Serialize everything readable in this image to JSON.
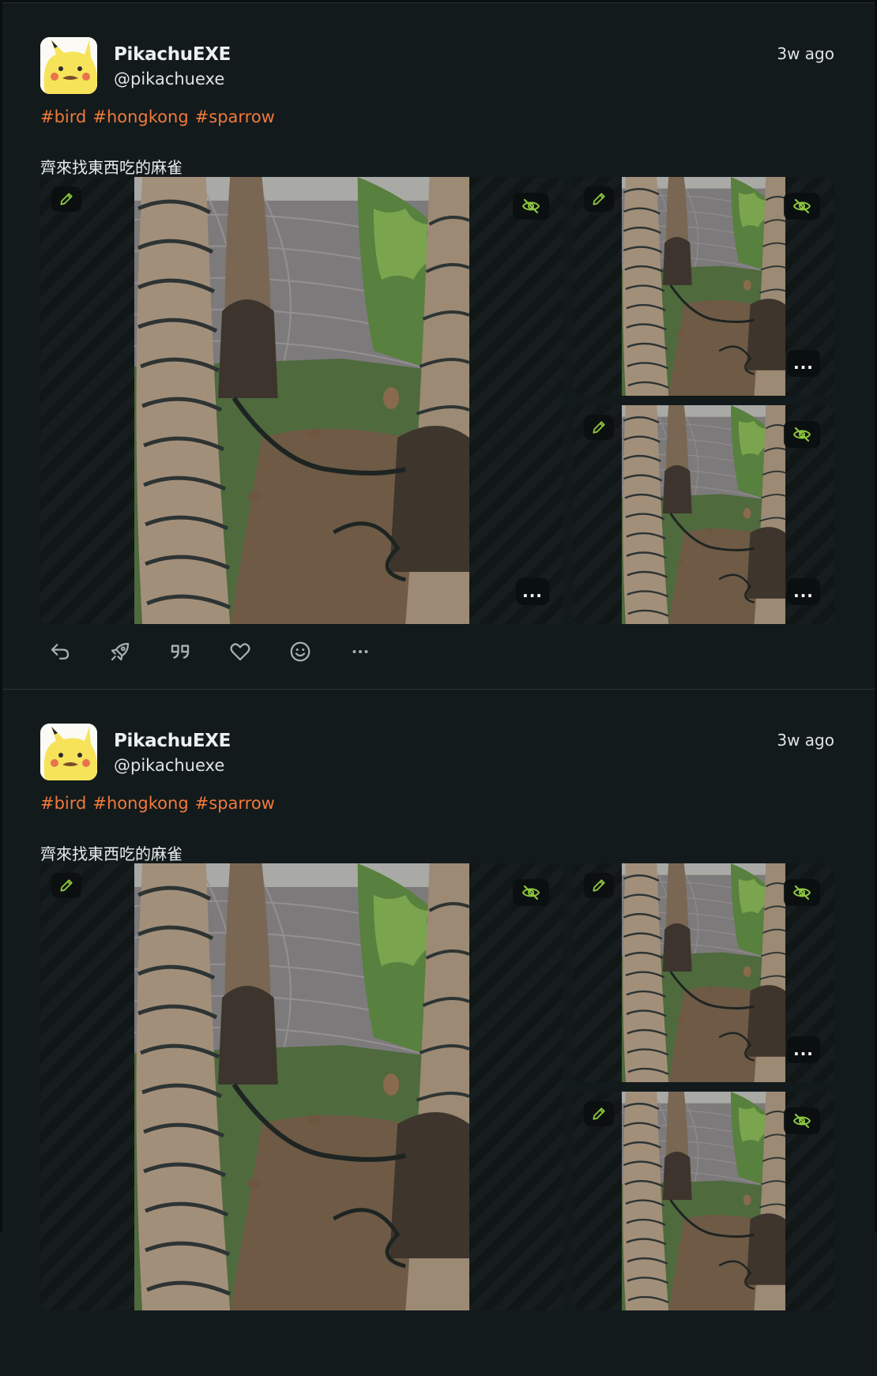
{
  "colors": {
    "background": "#121a1c",
    "hashtag": "#f07a3a",
    "accent_icon": "#8dc63f"
  },
  "posts": [
    {
      "author": {
        "display_name": "PikachuEXE",
        "handle": "@pikachuexe"
      },
      "time_ago": "3w ago",
      "hashtags": [
        "#bird",
        "#hongkong",
        "#sparrow"
      ],
      "text": "齊來找東西吃的麻雀",
      "media": [
        {
          "icon_alt": "pencil-icon",
          "icon_hide": "eye-off-icon",
          "more": "..."
        },
        {
          "icon_alt": "pencil-icon",
          "icon_hide": "eye-off-icon",
          "more": "..."
        },
        {
          "icon_alt": "pencil-icon",
          "icon_hide": "eye-off-icon",
          "more": "..."
        }
      ],
      "actions": [
        "reply-icon",
        "boost-icon",
        "quote-icon",
        "favourite-icon",
        "emoji-reaction-icon",
        "more-icon"
      ]
    },
    {
      "author": {
        "display_name": "PikachuEXE",
        "handle": "@pikachuexe"
      },
      "time_ago": "3w ago",
      "hashtags": [
        "#bird",
        "#hongkong",
        "#sparrow"
      ],
      "text": "齊來找東西吃的麻雀",
      "media": [
        {
          "icon_alt": "pencil-icon",
          "icon_hide": "eye-off-icon",
          "more": "..."
        },
        {
          "icon_alt": "pencil-icon",
          "icon_hide": "eye-off-icon",
          "more": "..."
        },
        {
          "icon_alt": "pencil-icon",
          "icon_hide": "eye-off-icon"
        }
      ],
      "actions": []
    }
  ]
}
